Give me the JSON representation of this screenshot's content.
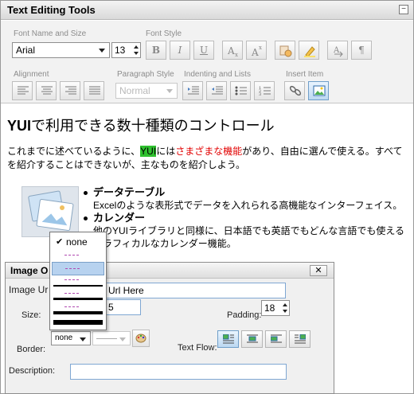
{
  "editor": {
    "title": "Text Editing Tools",
    "minimize_label": "−"
  },
  "toolbar": {
    "groups": {
      "font_name_size": "Font Name and Size",
      "font_style": "Font Style",
      "alignment": "Alignment",
      "paragraph_style": "Paragraph Style",
      "indenting_lists": "Indenting and Lists",
      "insert_item": "Insert Item"
    },
    "font_name": "Arial",
    "font_size": "13",
    "paragraph_style": "Normal",
    "bold_label": "B",
    "italic_label": "I",
    "underline_label": "U",
    "subscript_label": "Ax",
    "superscript_label": "Ax",
    "paragraph_label": "¶"
  },
  "content": {
    "heading_bold": "YUI",
    "heading_rest": "で利用できる数十種類のコントロール",
    "para_part1": "これまでに述べているように、",
    "para_hl": "YUI",
    "para_part2": "には",
    "para_red": "さまざまな機能",
    "para_part3": "があり、自由に選んで使える。すべてを紹介することはできないが、主なものを紹介しよう。",
    "bullets": [
      {
        "title": "データテーブル",
        "desc": "Excelのような表形式でデータを入れられる高機能なインターフェイス。"
      },
      {
        "title": "カレンダー",
        "desc": "他のYUIライブラリと同様に、日本語でも英語でもどんな言語でも使えるグラフィカルなカレンダー機能。"
      }
    ]
  },
  "dialog": {
    "title": "Image O",
    "close_label": "✕",
    "image_url_label": "Image Ur",
    "image_url_value": "Url Here",
    "size_label": "Size:",
    "size_value": "5",
    "padding_label": "Padding:",
    "padding_value": "18",
    "border_label": "Border:",
    "border_value": "none",
    "text_flow_label": "Text Flow:",
    "description_label": "Description:",
    "description_value": ""
  },
  "border_dropdown": {
    "options": [
      "none",
      "dashed-thin",
      "solid-thin",
      "dashed",
      "solid",
      "dashed-thick",
      "solid-thick"
    ],
    "selected_label": "none"
  },
  "colors": {
    "highlight_green": "#2fc02f",
    "text_red": "#e20000",
    "active_blue": "#bcd8f1"
  }
}
